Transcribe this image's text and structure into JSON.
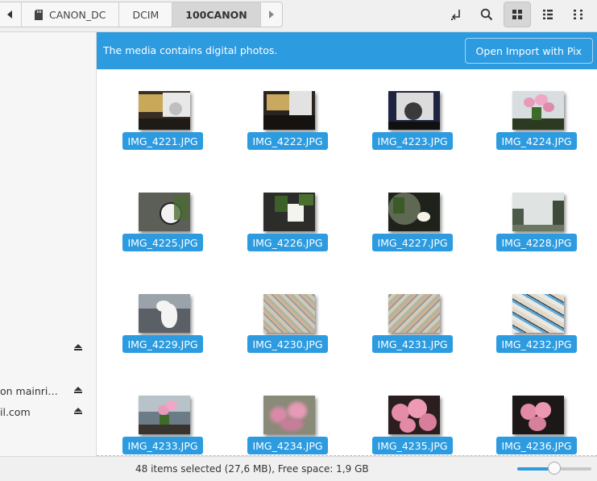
{
  "pathbar": {
    "crumbs": [
      "CANON_DC",
      "DCIM",
      "100CANON"
    ],
    "active_index": 2
  },
  "toolbar": {
    "icons": [
      "open-terminal-icon",
      "search-icon",
      "grid-view-icon",
      "list-view-icon",
      "view-options-icon"
    ],
    "active_view": "grid"
  },
  "sidebar": {
    "items": [
      {
        "label": "on mainri…",
        "eject": true
      },
      {
        "label": "il.com",
        "eject": true
      }
    ]
  },
  "banner": {
    "message": "The media contains digital photos.",
    "button_label": "Open Import with Pix"
  },
  "files": [
    {
      "name": "IMG_4221.JPG",
      "scene": "desk"
    },
    {
      "name": "IMG_4222.JPG",
      "scene": "desk2"
    },
    {
      "name": "IMG_4223.JPG",
      "scene": "desk3"
    },
    {
      "name": "IMG_4224.JPG",
      "scene": "roses-window"
    },
    {
      "name": "IMG_4225.JPG",
      "scene": "clock"
    },
    {
      "name": "IMG_4226.JPG",
      "scene": "lamp-plant"
    },
    {
      "name": "IMG_4227.JPG",
      "scene": "lamp-dark"
    },
    {
      "name": "IMG_4228.JPG",
      "scene": "trees"
    },
    {
      "name": "IMG_4229.JPG",
      "scene": "moomin"
    },
    {
      "name": "IMG_4230.JPG",
      "scene": "pattern"
    },
    {
      "name": "IMG_4231.JPG",
      "scene": "pattern2"
    },
    {
      "name": "IMG_4232.JPG",
      "scene": "pattern-blue"
    },
    {
      "name": "IMG_4233.JPG",
      "scene": "roses-window2"
    },
    {
      "name": "IMG_4234.JPG",
      "scene": "roses-blur"
    },
    {
      "name": "IMG_4235.JPG",
      "scene": "roses-close"
    },
    {
      "name": "IMG_4236.JPG",
      "scene": "roses-dark"
    }
  ],
  "status": {
    "text": "48 items selected (27,6 MB), Free space: 1,9 GB",
    "zoom_level": 0.5
  },
  "colors": {
    "accent": "#2d9be0"
  }
}
